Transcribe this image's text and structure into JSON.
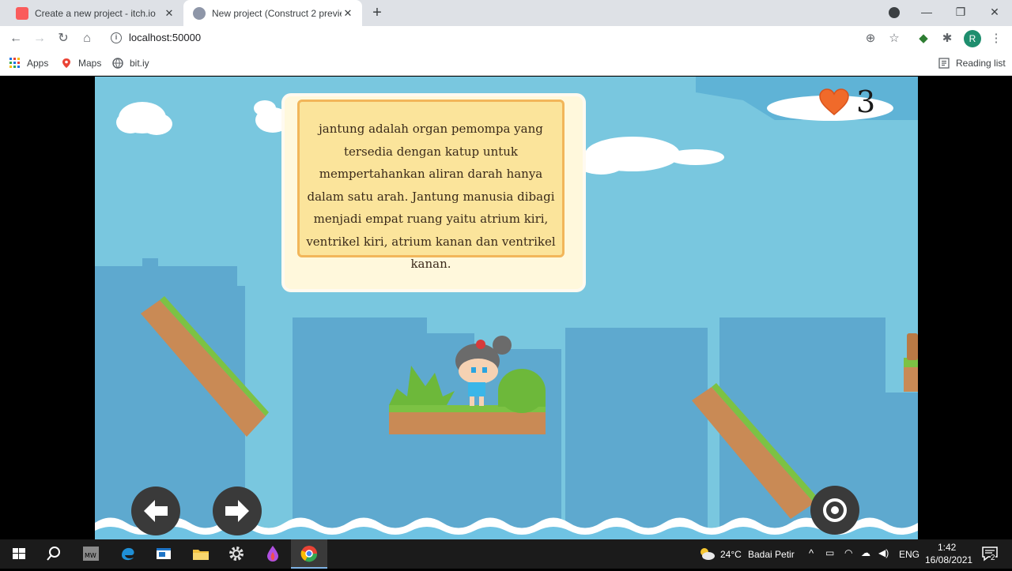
{
  "browser": {
    "tabs": [
      {
        "title": "Create a new project - itch.io",
        "active": false
      },
      {
        "title": "New project (Construct 2 preview",
        "active": true
      }
    ],
    "address": "localhost:50000",
    "bookmarks": [
      "Apps",
      "Maps",
      "bit.iy"
    ],
    "reading_list": "Reading list",
    "profile_initial": "R"
  },
  "game": {
    "info_text": "jantung adalah organ pemompa yang tersedia dengan katup untuk mempertahankan aliran darah hanya dalam satu arah. Jantung manusia dibagi menjadi empat ruang yaitu atrium kiri, ventrikel kiri, atrium kanan dan ventrikel kanan.",
    "lives": "3",
    "colors": {
      "sky": "#79c7df",
      "buildings": "#5ea9cf",
      "grass": "#7cc244",
      "dirt": "#c98a55",
      "water": "#6fc3e3"
    }
  },
  "taskbar": {
    "weather_temp": "24°C",
    "weather_desc": "Badai Petir",
    "language": "ENG",
    "time": "1:42",
    "date": "16/08/2021",
    "notification_count": "2"
  }
}
